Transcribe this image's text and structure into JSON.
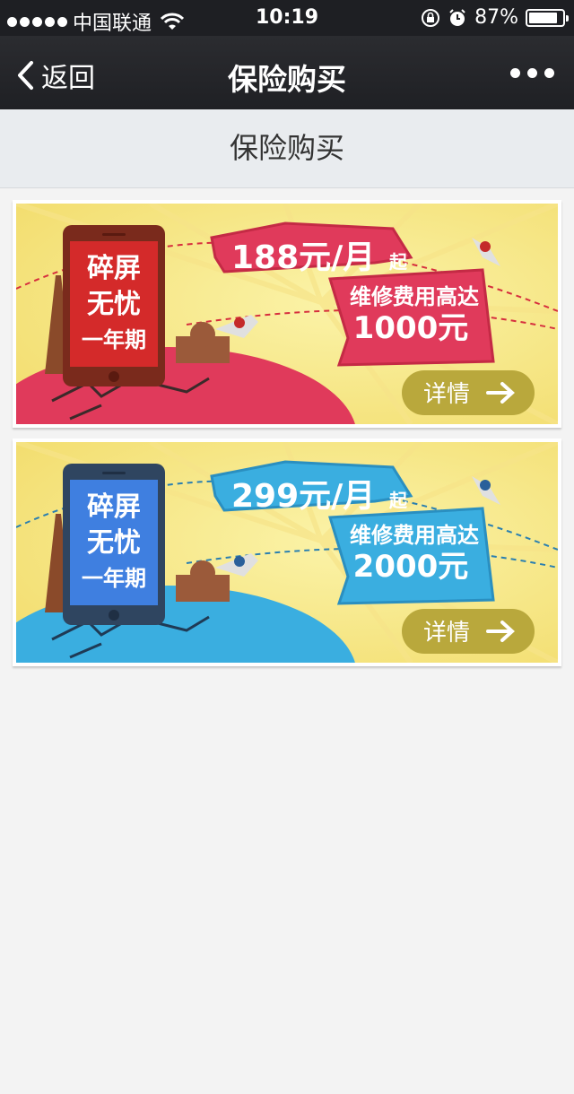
{
  "status_bar": {
    "carrier": "中国联通",
    "time": "10:19",
    "battery_percent": "87%",
    "battery_level": 0.87
  },
  "nav": {
    "back_label": "返回",
    "title": "保险购买",
    "more_icon": "more-dots-icon"
  },
  "page": {
    "header_title": "保险购买"
  },
  "banners": [
    {
      "phone_text": [
        "碎屏",
        "无忧",
        "一年期"
      ],
      "price": "188元/月",
      "price_suffix": "起",
      "coverage_line": "维修费用高达",
      "coverage_amount": "1000元",
      "button_label": "详情",
      "theme_color": "#e03a5b",
      "phone_color": "#7a2a1c",
      "screen_color": "#d42a2a"
    },
    {
      "phone_text": [
        "碎屏",
        "无忧",
        "一年期"
      ],
      "price": "299元/月",
      "price_suffix": "起",
      "coverage_line": "维修费用高达",
      "coverage_amount": "2000元",
      "button_label": "详情",
      "theme_color": "#3aaee0",
      "phone_color": "#2f4560",
      "screen_color": "#3f7fe0"
    }
  ]
}
